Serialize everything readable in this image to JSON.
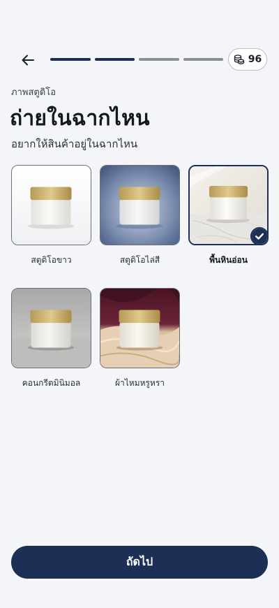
{
  "header": {
    "credits": "96",
    "progress": {
      "total_steps": 4,
      "current_step": 2
    }
  },
  "content": {
    "eyebrow": "ภาพสตูดิโอ",
    "title": "ถ่ายในฉากไหน",
    "subtitle": "อยากให้สินค้าอยู่ในฉากไหน"
  },
  "options": [
    {
      "label": "สตูดิโอขาว",
      "scene": "white-studio",
      "selected": false
    },
    {
      "label": "สตูดิโอไล่สี",
      "scene": "gradient-studio",
      "selected": false
    },
    {
      "label": "พื้นหินอ่อน",
      "scene": "marble",
      "selected": true
    },
    {
      "label": "คอนกรีตมินิมอล",
      "scene": "concrete",
      "selected": false
    },
    {
      "label": "ผ้าไหมหรูหรา",
      "scene": "silk",
      "selected": false
    }
  ],
  "footer": {
    "next_label": "ถัดไป"
  },
  "colors": {
    "primary": "#1c2f55",
    "background": "#f3f5f8",
    "inactive_segment": "#8c8f94"
  }
}
